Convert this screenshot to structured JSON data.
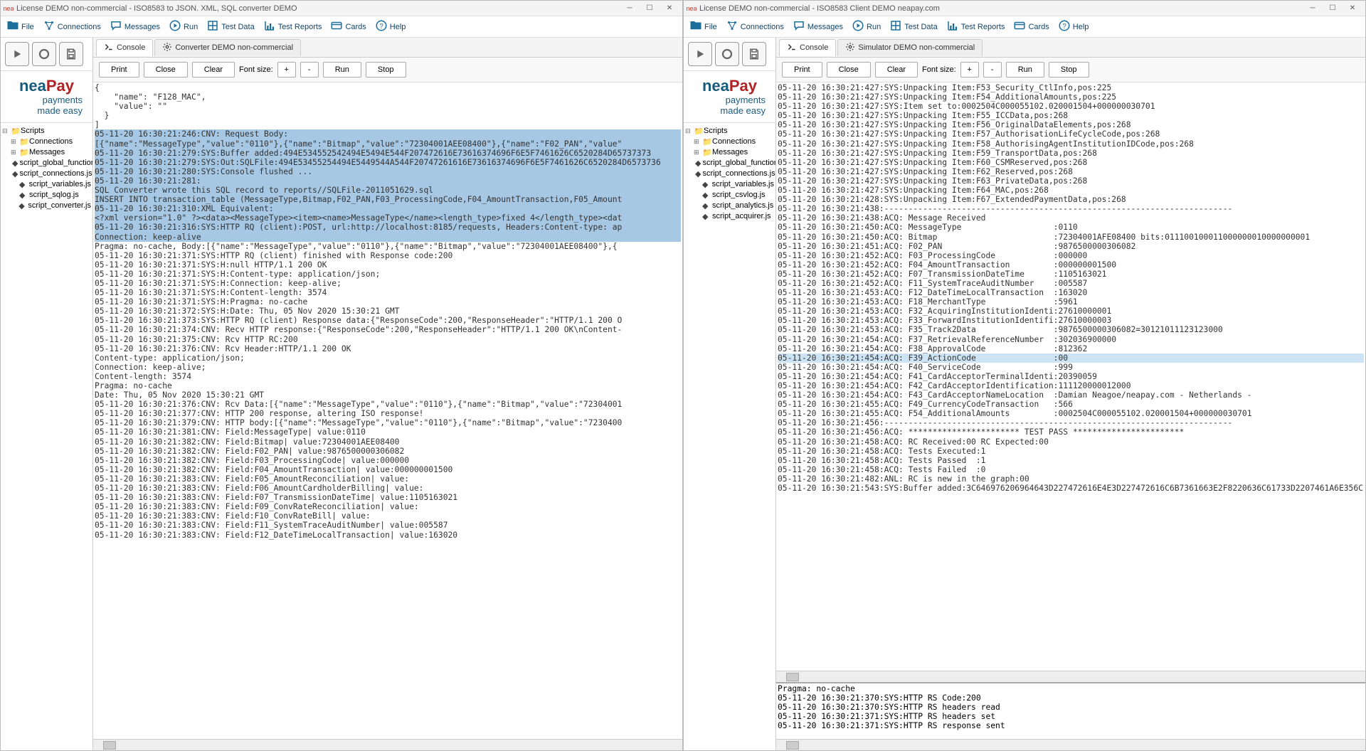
{
  "windows": [
    {
      "id": "left",
      "title": "License DEMO non-commercial - ISO8583 to JSON. XML, SQL converter DEMO",
      "toolbar": [
        {
          "icon": "folder",
          "label": "File"
        },
        {
          "icon": "conn",
          "label": "Connections"
        },
        {
          "icon": "msg",
          "label": "Messages"
        },
        {
          "icon": "play",
          "label": "Run"
        },
        {
          "icon": "grid",
          "label": "Test Data"
        },
        {
          "icon": "chart",
          "label": "Test Reports"
        },
        {
          "icon": "cards",
          "label": "Cards"
        },
        {
          "icon": "help",
          "label": "Help"
        }
      ],
      "logo_sub1": "payments",
      "logo_sub2": "made easy",
      "tree": [
        {
          "i": 0,
          "t": "folder",
          "e": "-",
          "label": "Scripts"
        },
        {
          "i": 1,
          "t": "folder",
          "e": "+",
          "label": "Connections"
        },
        {
          "i": 1,
          "t": "folder",
          "e": "+",
          "label": "Messages"
        },
        {
          "i": 1,
          "t": "file",
          "label": "script_global_functions.js"
        },
        {
          "i": 1,
          "t": "file",
          "label": "script_connections.js"
        },
        {
          "i": 1,
          "t": "file",
          "label": "script_variables.js"
        },
        {
          "i": 1,
          "t": "file",
          "label": "script_sqlog.js"
        },
        {
          "i": 1,
          "t": "file",
          "label": "script_converter.js"
        }
      ],
      "tabs": [
        {
          "icon": "console",
          "label": "Console",
          "active": true
        },
        {
          "icon": "gear",
          "label": "Converter DEMO non-commercial",
          "active": false
        }
      ],
      "buttons": {
        "print": "Print",
        "close": "Close",
        "clear": "Clear",
        "fontsize": "Font size:",
        "plus": "+",
        "minus": "-",
        "run": "Run",
        "stop": "Stop"
      },
      "console_lines": {
        "pre": [
          "{",
          "    \"name\": \"F128_MAC\",",
          "    \"value\": \"\"",
          "  }",
          "]"
        ],
        "hl": [
          "05-11-20 16:30:21:246:CNV: Request Body:",
          "[{\"name\":\"MessageType\",\"value\":\"0110\"},{\"name\":\"Bitmap\",\"value\":\"72304001AEE08400\"},{\"name\":\"F02_PAN\",\"value\"",
          "05-11-20 16:30:21:279:SYS:Buffer added:494E534552542494E5494E544F207472616E73616374696F6E5F7461626C6520284D65737373",
          "05-11-20 16:30:21:279:SYS:Out:SQLFile:494E53455254494E5449544A544F20747261616E73616374696F6E5F7461626C6520284D6573736",
          "05-11-20 16:30:21:280:SYS:Console flushed ...",
          "05-11-20 16:30:21:281:",
          "",
          "SQL Converter wrote this SQL record to reports//SQLFile-2011051629.sql",
          "INSERT INTO transaction_table (MessageType,Bitmap,F02_PAN,F03_ProcessingCode,F04_AmountTransaction,F05_Amount",
          "",
          "05-11-20 16:30:21:310:XML Equivalent:",
          "<?xml version=\"1.0\" ?><data><MessageType><item><name>MessageType</name><length_type>fixed 4</length_type><dat",
          "05-11-20 16:30:21:316:SYS:HTTP RQ (client):POST, url:http://localhost:8185/requests, Headers:Content-type: ap",
          "Connection: keep-alive"
        ],
        "post": [
          "Pragma: no-cache, Body:[{\"name\":\"MessageType\",\"value\":\"0110\"},{\"name\":\"Bitmap\",\"value\":\"72304001AEE08400\"},{",
          "05-11-20 16:30:21:371:SYS:HTTP RQ (client) finished with Response code:200",
          "05-11-20 16:30:21:371:SYS:H:null HTTP/1.1 200 OK",
          "05-11-20 16:30:21:371:SYS:H:Content-type: application/json;",
          "05-11-20 16:30:21:371:SYS:H:Connection: keep-alive;",
          "05-11-20 16:30:21:371:SYS:H:Content-length: 3574",
          "05-11-20 16:30:21:371:SYS:H:Pragma: no-cache",
          "05-11-20 16:30:21:372:SYS:H:Date: Thu, 05 Nov 2020 15:30:21 GMT",
          "05-11-20 16:30:21:373:SYS:HTTP RQ (client) Response data:{\"ResponseCode\":200,\"ResponseHeader\":\"HTTP/1.1 200 O",
          "05-11-20 16:30:21:374:CNV: Recv HTTP response:{\"ResponseCode\":200,\"ResponseHeader\":\"HTTP/1.1 200 OK\\nContent-",
          "05-11-20 16:30:21:375:CNV: Rcv HTTP RC:200",
          "05-11-20 16:30:21:376:CNV: Rcv Header:HTTP/1.1 200 OK",
          "Content-type: application/json;",
          "Connection: keep-alive;",
          "Content-length: 3574",
          "Pragma: no-cache",
          "Date: Thu, 05 Nov 2020 15:30:21 GMT",
          "",
          "05-11-20 16:30:21:376:CNV: Rcv Data:[{\"name\":\"MessageType\",\"value\":\"0110\"},{\"name\":\"Bitmap\",\"value\":\"72304001",
          "05-11-20 16:30:21:377:CNV: HTTP 200 response, altering ISO response!",
          "05-11-20 16:30:21:379:CNV: HTTP body:[{\"name\":\"MessageType\",\"value\":\"0110\"},{\"name\":\"Bitmap\",\"value\":\"7230400",
          "05-11-20 16:30:21:381:CNV: Field:MessageType| value:0110",
          "05-11-20 16:30:21:382:CNV: Field:Bitmap| value:72304001AEE08400",
          "05-11-20 16:30:21:382:CNV: Field:F02_PAN| value:9876500000306082",
          "05-11-20 16:30:21:382:CNV: Field:F03_ProcessingCode| value:000000",
          "05-11-20 16:30:21:382:CNV: Field:F04_AmountTransaction| value:000000001500",
          "05-11-20 16:30:21:383:CNV: Field:F05_AmountReconciliation| value:",
          "05-11-20 16:30:21:383:CNV: Field:F06_AmountCardholderBilling| value:",
          "05-11-20 16:30:21:383:CNV: Field:F07_TransmissionDateTime| value:1105163021",
          "05-11-20 16:30:21:383:CNV: Field:F09_ConvRateReconciliation| value:",
          "05-11-20 16:30:21:383:CNV: Field:F10_ConvRateBill| value:",
          "05-11-20 16:30:21:383:CNV: Field:F11_SystemTraceAuditNumber| value:005587",
          "05-11-20 16:30:21:383:CNV: Field:F12_DateTimeLocalTransaction| value:163020"
        ]
      }
    },
    {
      "id": "right",
      "title": "License DEMO non-commercial - ISO8583 Client DEMO neapay.com",
      "toolbar": [
        {
          "icon": "folder",
          "label": "File"
        },
        {
          "icon": "conn",
          "label": "Connections"
        },
        {
          "icon": "msg",
          "label": "Messages"
        },
        {
          "icon": "play",
          "label": "Run"
        },
        {
          "icon": "grid",
          "label": "Test Data"
        },
        {
          "icon": "chart",
          "label": "Test Reports"
        },
        {
          "icon": "cards",
          "label": "Cards"
        },
        {
          "icon": "help",
          "label": "Help"
        }
      ],
      "logo_sub1": "payments",
      "logo_sub2": "made easy",
      "tree": [
        {
          "i": 0,
          "t": "folder",
          "e": "-",
          "label": "Scripts"
        },
        {
          "i": 1,
          "t": "folder",
          "e": "+",
          "label": "Connections"
        },
        {
          "i": 1,
          "t": "folder",
          "e": "+",
          "label": "Messages"
        },
        {
          "i": 1,
          "t": "file",
          "label": "script_global_functions.js"
        },
        {
          "i": 1,
          "t": "file",
          "label": "script_connections.js"
        },
        {
          "i": 1,
          "t": "file",
          "label": "script_variables.js"
        },
        {
          "i": 1,
          "t": "file",
          "label": "script_csvlog.js"
        },
        {
          "i": 1,
          "t": "file",
          "label": "script_analytics.js"
        },
        {
          "i": 1,
          "t": "file",
          "label": "script_acquirer.js"
        }
      ],
      "tabs": [
        {
          "icon": "console",
          "label": "Console",
          "active": true
        },
        {
          "icon": "gear",
          "label": "Simulator DEMO non-commercial",
          "active": false
        }
      ],
      "buttons": {
        "print": "Print",
        "close": "Close",
        "clear": "Clear",
        "fontsize": "Font size:",
        "plus": "+",
        "minus": "-",
        "run": "Run",
        "stop": "Stop"
      },
      "console_top": [
        "05-11-20 16:30:21:427:SYS:Unpacking Item:F53_Security_CtlInfo,pos:225",
        "05-11-20 16:30:21:427:SYS:Unpacking Item:F54_AdditionalAmounts,pos:225",
        "05-11-20 16:30:21:427:SYS:Item set to:0002504C000055102.020001504+000000030701",
        "05-11-20 16:30:21:427:SYS:Unpacking Item:F55_ICCData,pos:268",
        "05-11-20 16:30:21:427:SYS:Unpacking Item:F56_OriginalDataElements,pos:268",
        "05-11-20 16:30:21:427:SYS:Unpacking Item:F57_AuthorisationLifeCycleCode,pos:268",
        "05-11-20 16:30:21:427:SYS:Unpacking Item:F58_AuthorisingAgentInstitutionIDCode,pos:268",
        "05-11-20 16:30:21:427:SYS:Unpacking Item:F59_TransportData,pos:268",
        "05-11-20 16:30:21:427:SYS:Unpacking Item:F60_CSMReserved,pos:268",
        "05-11-20 16:30:21:427:SYS:Unpacking Item:F62_Reserved,pos:268",
        "05-11-20 16:30:21:427:SYS:Unpacking Item:F63_PrivateData,pos:268",
        "05-11-20 16:30:21:427:SYS:Unpacking Item:F64_MAC,pos:268",
        "05-11-20 16:30:21:428:SYS:Unpacking Item:F67_ExtendedPaymentData,pos:268",
        "05-11-20 16:30:21:438:------------------------------------------------------------------------",
        "05-11-20 16:30:21:438:ACQ: Message Received",
        "05-11-20 16:30:21:450:ACQ: MessageType                   :0110",
        "05-11-20 16:30:21:450:ACQ: Bitmap                        :72304001AFE08400 bits:011100100011000000010000000001",
        "05-11-20 16:30:21:451:ACQ: F02_PAN                       :9876500000306082",
        "05-11-20 16:30:21:452:ACQ: F03_ProcessingCode            :000000",
        "05-11-20 16:30:21:452:ACQ: F04_AmountTransaction         :000000001500",
        "05-11-20 16:30:21:452:ACQ: F07_TransmissionDateTime      :1105163021",
        "05-11-20 16:30:21:452:ACQ: F11_SystemTraceAuditNumber    :005587",
        "05-11-20 16:30:21:453:ACQ: F12_DateTimeLocalTransaction  :163020",
        "05-11-20 16:30:21:453:ACQ: F18_MerchantType              :5961",
        "05-11-20 16:30:21:453:ACQ: F32_AcquiringInstitutionIdenti:27610000001",
        "05-11-20 16:30:21:453:ACQ: F33_ForwardInstitutionIdentifi:27610000003",
        "05-11-20 16:30:21:453:ACQ: F35_Track2Data                :9876500000306082=30121011123123000",
        "05-11-20 16:30:21:454:ACQ: F37_RetrievalReferenceNumber  :302036900000",
        "05-11-20 16:30:21:454:ACQ: F38_ApprovalCode              :812362"
      ],
      "console_hl": "05-11-20 16:30:21:454:ACQ: F39_ActionCode                :00",
      "console_post": [
        "05-11-20 16:30:21:454:ACQ: F40_ServiceCode               :999",
        "05-11-20 16:30:21:454:ACQ: F41_CardAcceptorTerminalIdenti:20390059",
        "05-11-20 16:30:21:454:ACQ: F42_CardAcceptorIdentification:111120000012000",
        "05-11-20 16:30:21:454:ACQ: F43_CardAcceptorNameLocation  :Damian Neagoe/neapay.com - Netherlands -",
        "05-11-20 16:30:21:455:ACQ: F49_CurrencyCodeTransaction   :566",
        "05-11-20 16:30:21:455:ACQ: F54_AdditionalAmounts         :0002504C000055102.020001504+000000030701",
        "05-11-20 16:30:21:456:------------------------------------------------------------------------",
        "05-11-20 16:30:21:456:ACQ: *********************** TEST PASS ***********************",
        "05-11-20 16:30:21:458:ACQ: RC Received:00 RC Expected:00",
        "05-11-20 16:30:21:458:ACQ: Tests Executed:1",
        "05-11-20 16:30:21:458:ACQ: Tests Passed  :1",
        "05-11-20 16:30:21:458:ACQ: Tests Failed  :0",
        "05-11-20 16:30:21:482:ANL: RC is new in the graph:00",
        "05-11-20 16:30:21:543:SYS:Buffer added:3C646976206964643D227472616E4E3D227472616C6B7361663E2F8220636C61733D2207461A6E356C"
      ],
      "console_bottom": [
        "Pragma: no-cache",
        "05-11-20 16:30:21:370:SYS:HTTP RS Code:200",
        "05-11-20 16:30:21:370:SYS:HTTP RS headers read",
        "05-11-20 16:30:21:371:SYS:HTTP RS headers set",
        "05-11-20 16:30:21:371:SYS:HTTP RS response sent"
      ]
    }
  ]
}
